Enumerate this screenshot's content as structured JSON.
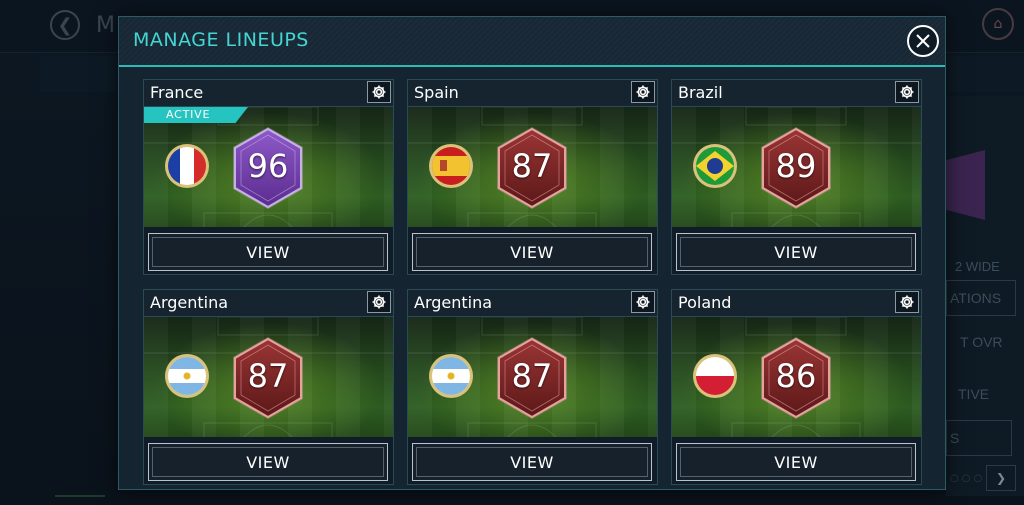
{
  "background": {
    "title_partial": "M",
    "right_labels": [
      "2 WIDE",
      "ATIONS",
      "T OVR",
      "TIVE",
      "S"
    ]
  },
  "modal": {
    "title": "MANAGE LINEUPS",
    "close_icon": "close-icon"
  },
  "lineups": [
    {
      "name": "France",
      "active": true,
      "active_label": "ACTIVE",
      "ovr": "96",
      "tier": "purple",
      "flag": "france",
      "view_label": "VIEW"
    },
    {
      "name": "Spain",
      "active": false,
      "ovr": "87",
      "tier": "red",
      "flag": "spain",
      "view_label": "VIEW"
    },
    {
      "name": "Brazil",
      "active": false,
      "ovr": "89",
      "tier": "red",
      "flag": "brazil",
      "view_label": "VIEW"
    },
    {
      "name": "Argentina",
      "active": false,
      "ovr": "87",
      "tier": "red",
      "flag": "argentina",
      "view_label": "VIEW"
    },
    {
      "name": "Argentina",
      "active": false,
      "ovr": "87",
      "tier": "red",
      "flag": "argentina",
      "view_label": "VIEW"
    },
    {
      "name": "Poland",
      "active": false,
      "ovr": "86",
      "tier": "red",
      "flag": "poland",
      "view_label": "VIEW"
    }
  ],
  "colors": {
    "accent": "#2fb9b5",
    "title": "#44d6d3",
    "tier_purple": "#7b3fb0",
    "tier_red": "#8a2a2a"
  }
}
